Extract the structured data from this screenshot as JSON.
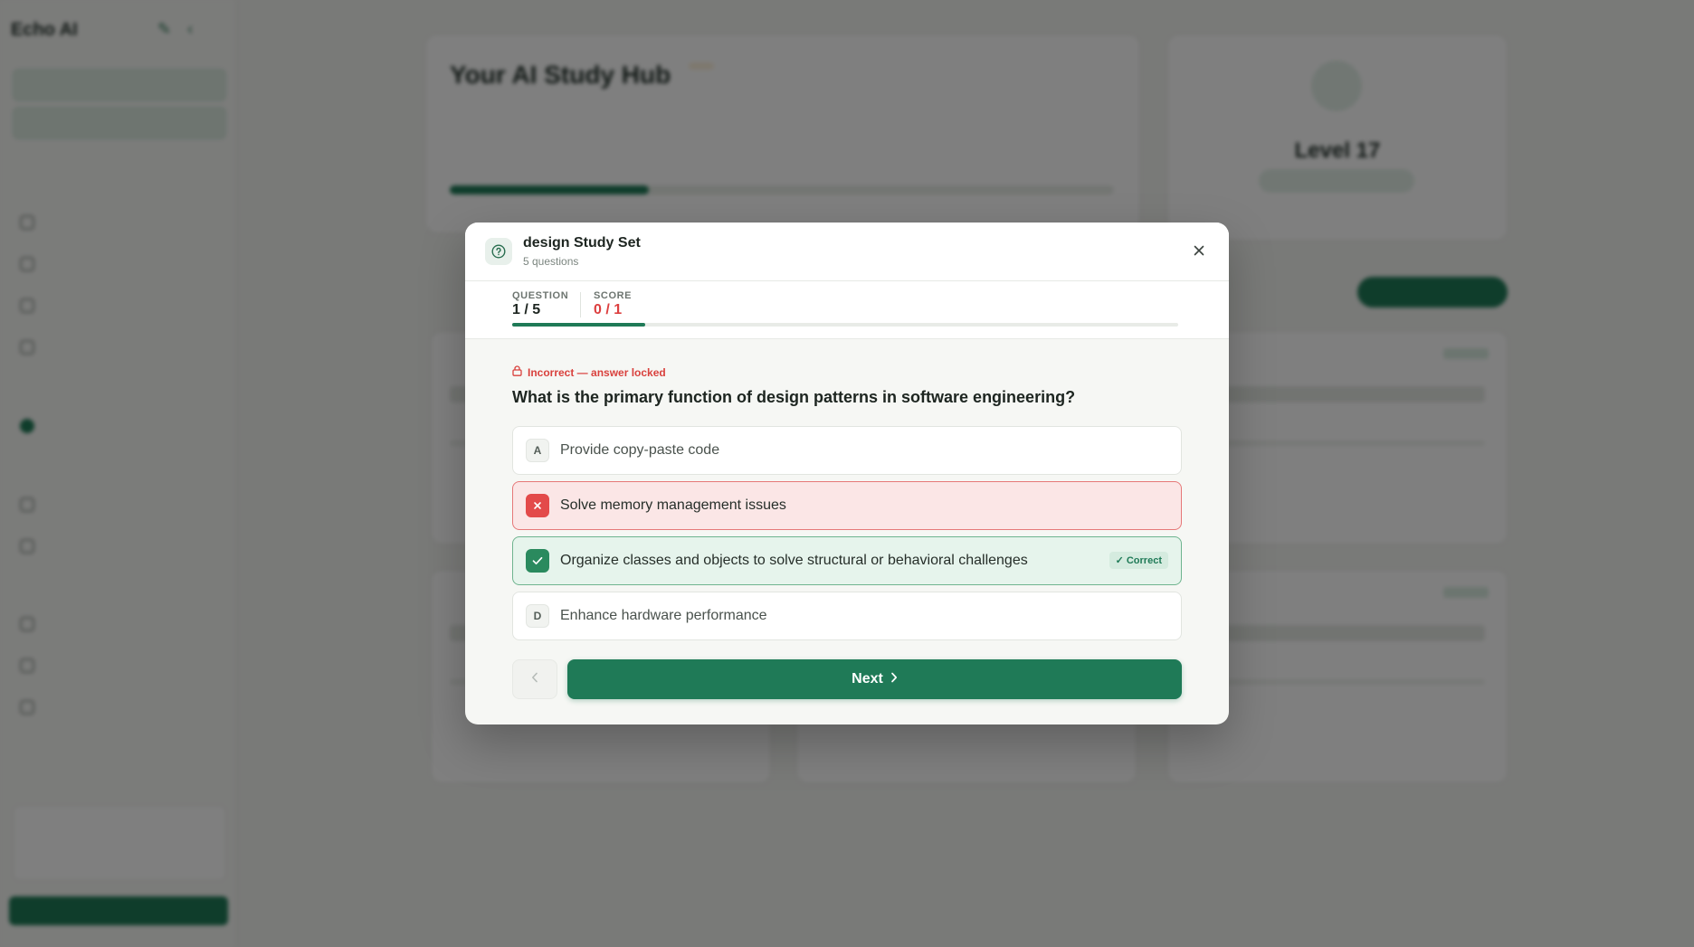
{
  "background": {
    "brand": "Echo AI",
    "hero_title": "Your AI Study Hub",
    "level": "Level 17"
  },
  "modal": {
    "title": "design Study Set",
    "subtitle": "5 questions",
    "question_label": "QUESTION",
    "question_value": "1 / 5",
    "score_label": "SCORE",
    "score_value": "0 / 1",
    "progress_fraction": 0.2,
    "status_text": "Incorrect — answer locked",
    "question": "What is the primary function of design patterns in software engineering?",
    "options": [
      {
        "letter": "A",
        "text": "Provide copy-paste code",
        "state": "neutral"
      },
      {
        "letter": "B",
        "text": "Solve memory management issues",
        "state": "wrong"
      },
      {
        "letter": "C",
        "text": "Organize classes and objects to solve structural or behavioral challenges",
        "state": "correct"
      },
      {
        "letter": "D",
        "text": "Enhance hardware performance",
        "state": "neutral"
      }
    ],
    "correct_tag": "✓ Correct",
    "next_label": "Next"
  },
  "colors": {
    "accent": "#1f7a57",
    "error": "#dc3f3f",
    "correct_bg": "#e6f4ec",
    "wrong_bg": "#fbe6e6"
  },
  "icons": [
    "question-circle-icon",
    "close-icon",
    "lock-icon",
    "x-icon",
    "check-icon",
    "chevron-left-icon",
    "chevron-right-icon"
  ]
}
